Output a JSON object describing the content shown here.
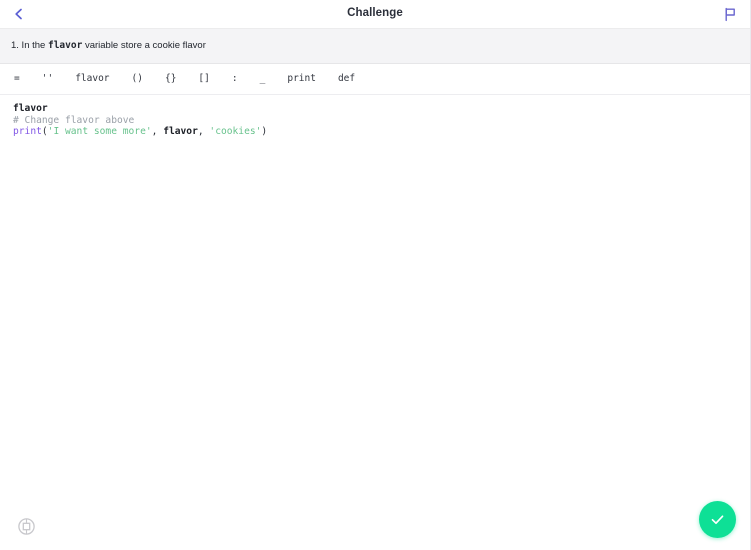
{
  "header": {
    "title": "Challenge",
    "back_icon": "chevron-left-icon",
    "flag_icon": "flag-icon",
    "accent_color": "#5b5fd4"
  },
  "instruction": {
    "prefix": "1. In the ",
    "code_word": "flavor",
    "suffix": " variable store a cookie flavor"
  },
  "token_bar": {
    "tokens": [
      {
        "label": "="
      },
      {
        "label": "''"
      },
      {
        "label": "flavor"
      },
      {
        "label": "()"
      },
      {
        "label": "{}"
      },
      {
        "label": "[]"
      },
      {
        "label": ":"
      },
      {
        "label": "_"
      },
      {
        "label": "print"
      },
      {
        "label": "def"
      }
    ]
  },
  "editor": {
    "lines": [
      {
        "parts": [
          {
            "text": "flavor",
            "style": "tok-var"
          }
        ]
      },
      {
        "parts": [
          {
            "text": "# Change flavor above",
            "style": "tok-comment"
          }
        ]
      },
      {
        "parts": [
          {
            "text": "print",
            "style": "tok-kw"
          },
          {
            "text": "(",
            "style": "tok-punc"
          },
          {
            "text": "'I want some more'",
            "style": "tok-str"
          },
          {
            "text": ", ",
            "style": "tok-punc"
          },
          {
            "text": "flavor",
            "style": "tok-var"
          },
          {
            "text": ", ",
            "style": "tok-punc"
          },
          {
            "text": "'cookies'",
            "style": "tok-str"
          },
          {
            "text": ")",
            "style": "tok-punc"
          }
        ]
      }
    ]
  },
  "footer": {
    "settings_icon": "settings-circle-icon",
    "submit_icon": "check-icon",
    "submit_color": "#0ee096"
  }
}
